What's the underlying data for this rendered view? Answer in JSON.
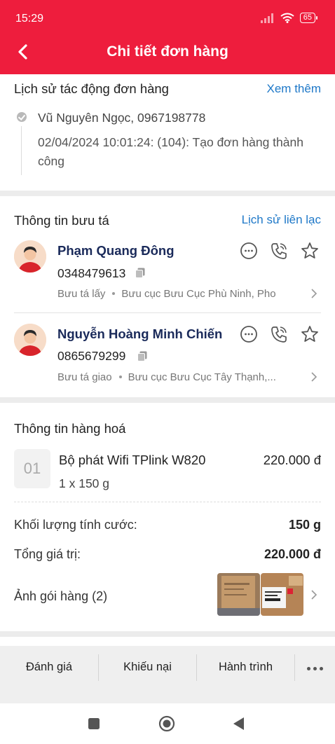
{
  "status_bar": {
    "time": "15:29",
    "battery": "65"
  },
  "header": {
    "title": "Chi tiết đơn hàng"
  },
  "history": {
    "title": "Lịch sử tác động đơn hàng",
    "more_label": "Xem thêm",
    "entries": [
      {
        "actor": "Vũ Nguyên Ngọc, 0967198778",
        "description": "02/04/2024 10:01:24: (104): Tạo đơn hàng thành công"
      }
    ]
  },
  "postmen": {
    "title": "Thông tin bưu tá",
    "contact_history_label": "Lịch sử liên lạc",
    "items": [
      {
        "name": "Phạm Quang Đông",
        "phone": "0348479613",
        "role": "Bưu tá lấy",
        "office": "Bưu cục Bưu Cục Phù Ninh, Pho"
      },
      {
        "name": "Nguyễn Hoàng Minh Chiến",
        "phone": "0865679299",
        "role": "Bưu tá giao",
        "office": "Bưu cục Bưu Cục Tây Thạnh,..."
      }
    ]
  },
  "goods": {
    "title": "Thông tin hàng hoá",
    "product": {
      "index": "01",
      "name": "Bộ phát Wifi TPlink W820",
      "price": "220.000 đ",
      "quantity": "1 x 150 g"
    },
    "weight_label": "Khối lượng tính cước:",
    "weight_value": "150 g",
    "total_label": "Tổng giá trị:",
    "total_value": "220.000 đ",
    "photos_label": "Ảnh gói hàng (2)"
  },
  "actions": {
    "rate": "Đánh giá",
    "complain": "Khiếu nại",
    "journey": "Hành trình"
  },
  "colors": {
    "brand": "#ee1d3d",
    "link": "#1e78c8",
    "name_text": "#1a2a5a"
  },
  "icons": [
    "back-arrow-icon",
    "chat-icon",
    "phone-call-icon",
    "star-icon",
    "copy-icon",
    "chevron-right-icon",
    "more-icon",
    "nav-square-icon",
    "nav-home-icon",
    "nav-back-icon"
  ]
}
